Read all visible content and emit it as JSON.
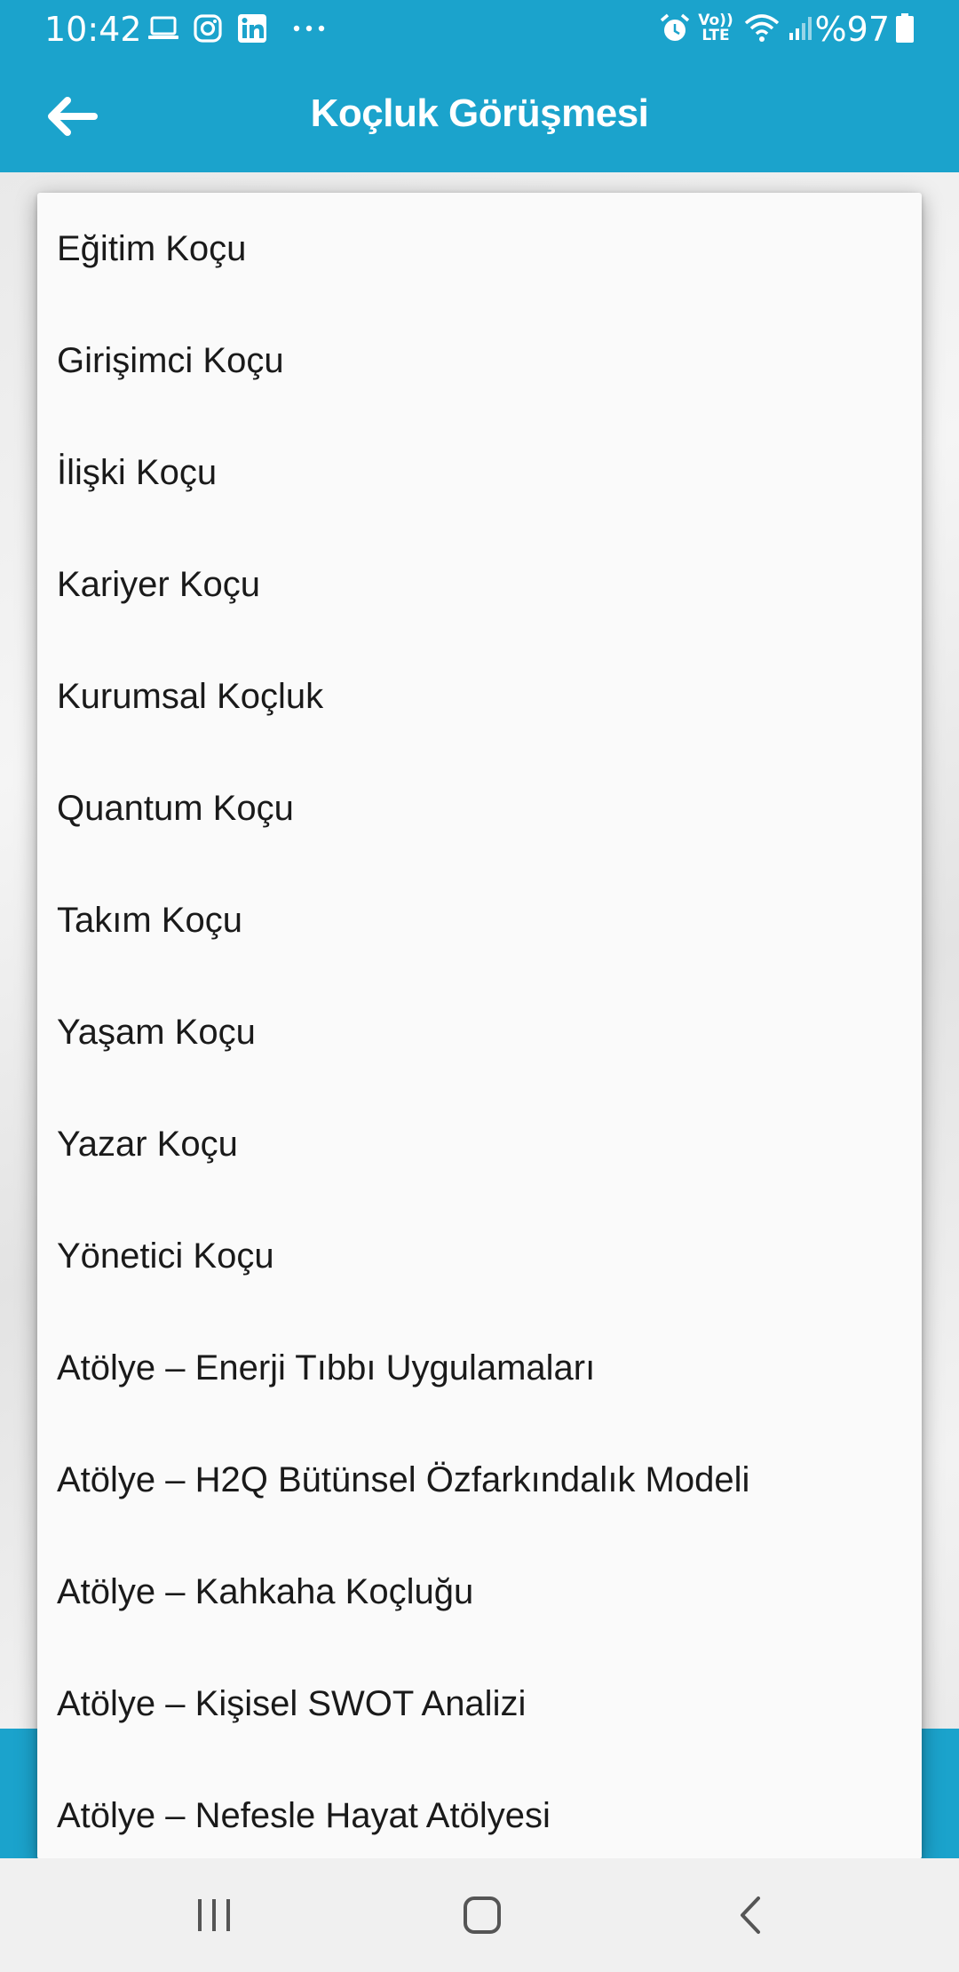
{
  "status_bar": {
    "time": "10:42",
    "battery_text": "%97",
    "volte_line1": "Vo))",
    "volte_line2": "LTE",
    "icons": [
      "laptop-icon",
      "instagram-icon",
      "linkedin-icon",
      "more-notifications-icon",
      "alarm-icon",
      "volte-icon",
      "wifi-icon",
      "signal-icon",
      "battery-icon"
    ]
  },
  "app_bar": {
    "title": "Koçluk Görüşmesi",
    "back_icon": "arrow-left-icon"
  },
  "dropdown": {
    "options": [
      "Eğitim Koçu",
      "Girişimci Koçu",
      "İlişki Koçu",
      "Kariyer Koçu",
      "Kurumsal Koçluk",
      "Quantum Koçu",
      "Takım Koçu",
      "Yaşam Koçu",
      "Yazar Koçu",
      "Yönetici Koçu",
      "Atölye – Enerji Tıbbı Uygulamaları",
      "Atölye – H2Q Bütünsel Özfarkındalık Modeli",
      "Atölye – Kahkaha Koçluğu",
      "Atölye – Kişisel SWOT Analizi",
      "Atölye – Nefesle Hayat Atölyesi"
    ]
  },
  "nav_bar": {
    "icons": [
      "recent-apps-icon",
      "home-icon",
      "back-icon"
    ]
  },
  "colors": {
    "accent": "#1ba3cc",
    "popup_bg": "#fafafa",
    "text": "#1a1a1a",
    "nav_bg": "#f0f0f0"
  }
}
